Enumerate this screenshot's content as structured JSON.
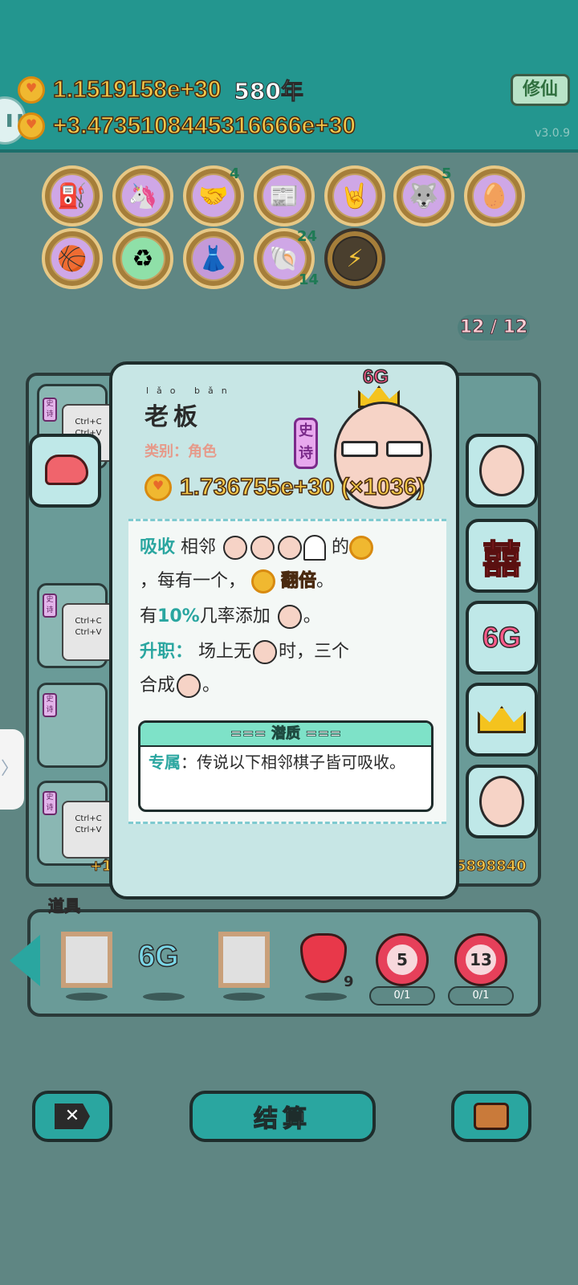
{
  "header": {
    "coins_total": "1.1519158e+30",
    "years": "580年",
    "coins_rate": "+3.4735108445316666e+30",
    "cultivate_button": "修仙",
    "version": "v3.0.9"
  },
  "items": {
    "badges": {
      "handshake": "4",
      "husky": "5",
      "shell_top": "24",
      "shell_bottom": "14"
    }
  },
  "counter": "12 / 12",
  "card": {
    "title": "老板",
    "title_pinyin": "lǎo bǎn",
    "category": "类别：角色",
    "epic": "史诗",
    "crown_label": "6G",
    "value": "1.736755e+30 (×1036)",
    "desc_line1_kw": "吸收",
    "desc_line1_text": "相邻",
    "desc_line1_tail": "的",
    "desc_line2": "，每有一个，",
    "desc_double": "翻倍",
    "desc_period": "。",
    "desc_line3_a": "有",
    "desc_line3_pct": "10%",
    "desc_line3_b": "几率添加",
    "desc_line4_kw": "升职：",
    "desc_line4_text": "场上无",
    "desc_line4_tail": "时，三个",
    "desc_line5_a": "合成",
    "potential_header": "=== 潜质 ===",
    "potential_kw": "专属",
    "potential_text": "：传说以下相邻棋子皆可吸收。"
  },
  "board": {
    "ctrl_c": "Ctrl+C",
    "ctrl_v": "Ctrl+V",
    "epic_small": "史诗",
    "right_number": "5898840",
    "left_plus": "+1",
    "right_xi": "囍",
    "right_6g": "6G"
  },
  "props": {
    "title": "道具",
    "sixg": "6G",
    "strawberry_count": "9",
    "target1": "5",
    "target1_pill": "0/1",
    "target2": "13",
    "target2_pill": "0/1"
  },
  "buttons": {
    "settle": "结算"
  },
  "colors": {
    "teal": "#2aa6a0",
    "gold": "#f4c84a",
    "bg": "#5f8683"
  }
}
